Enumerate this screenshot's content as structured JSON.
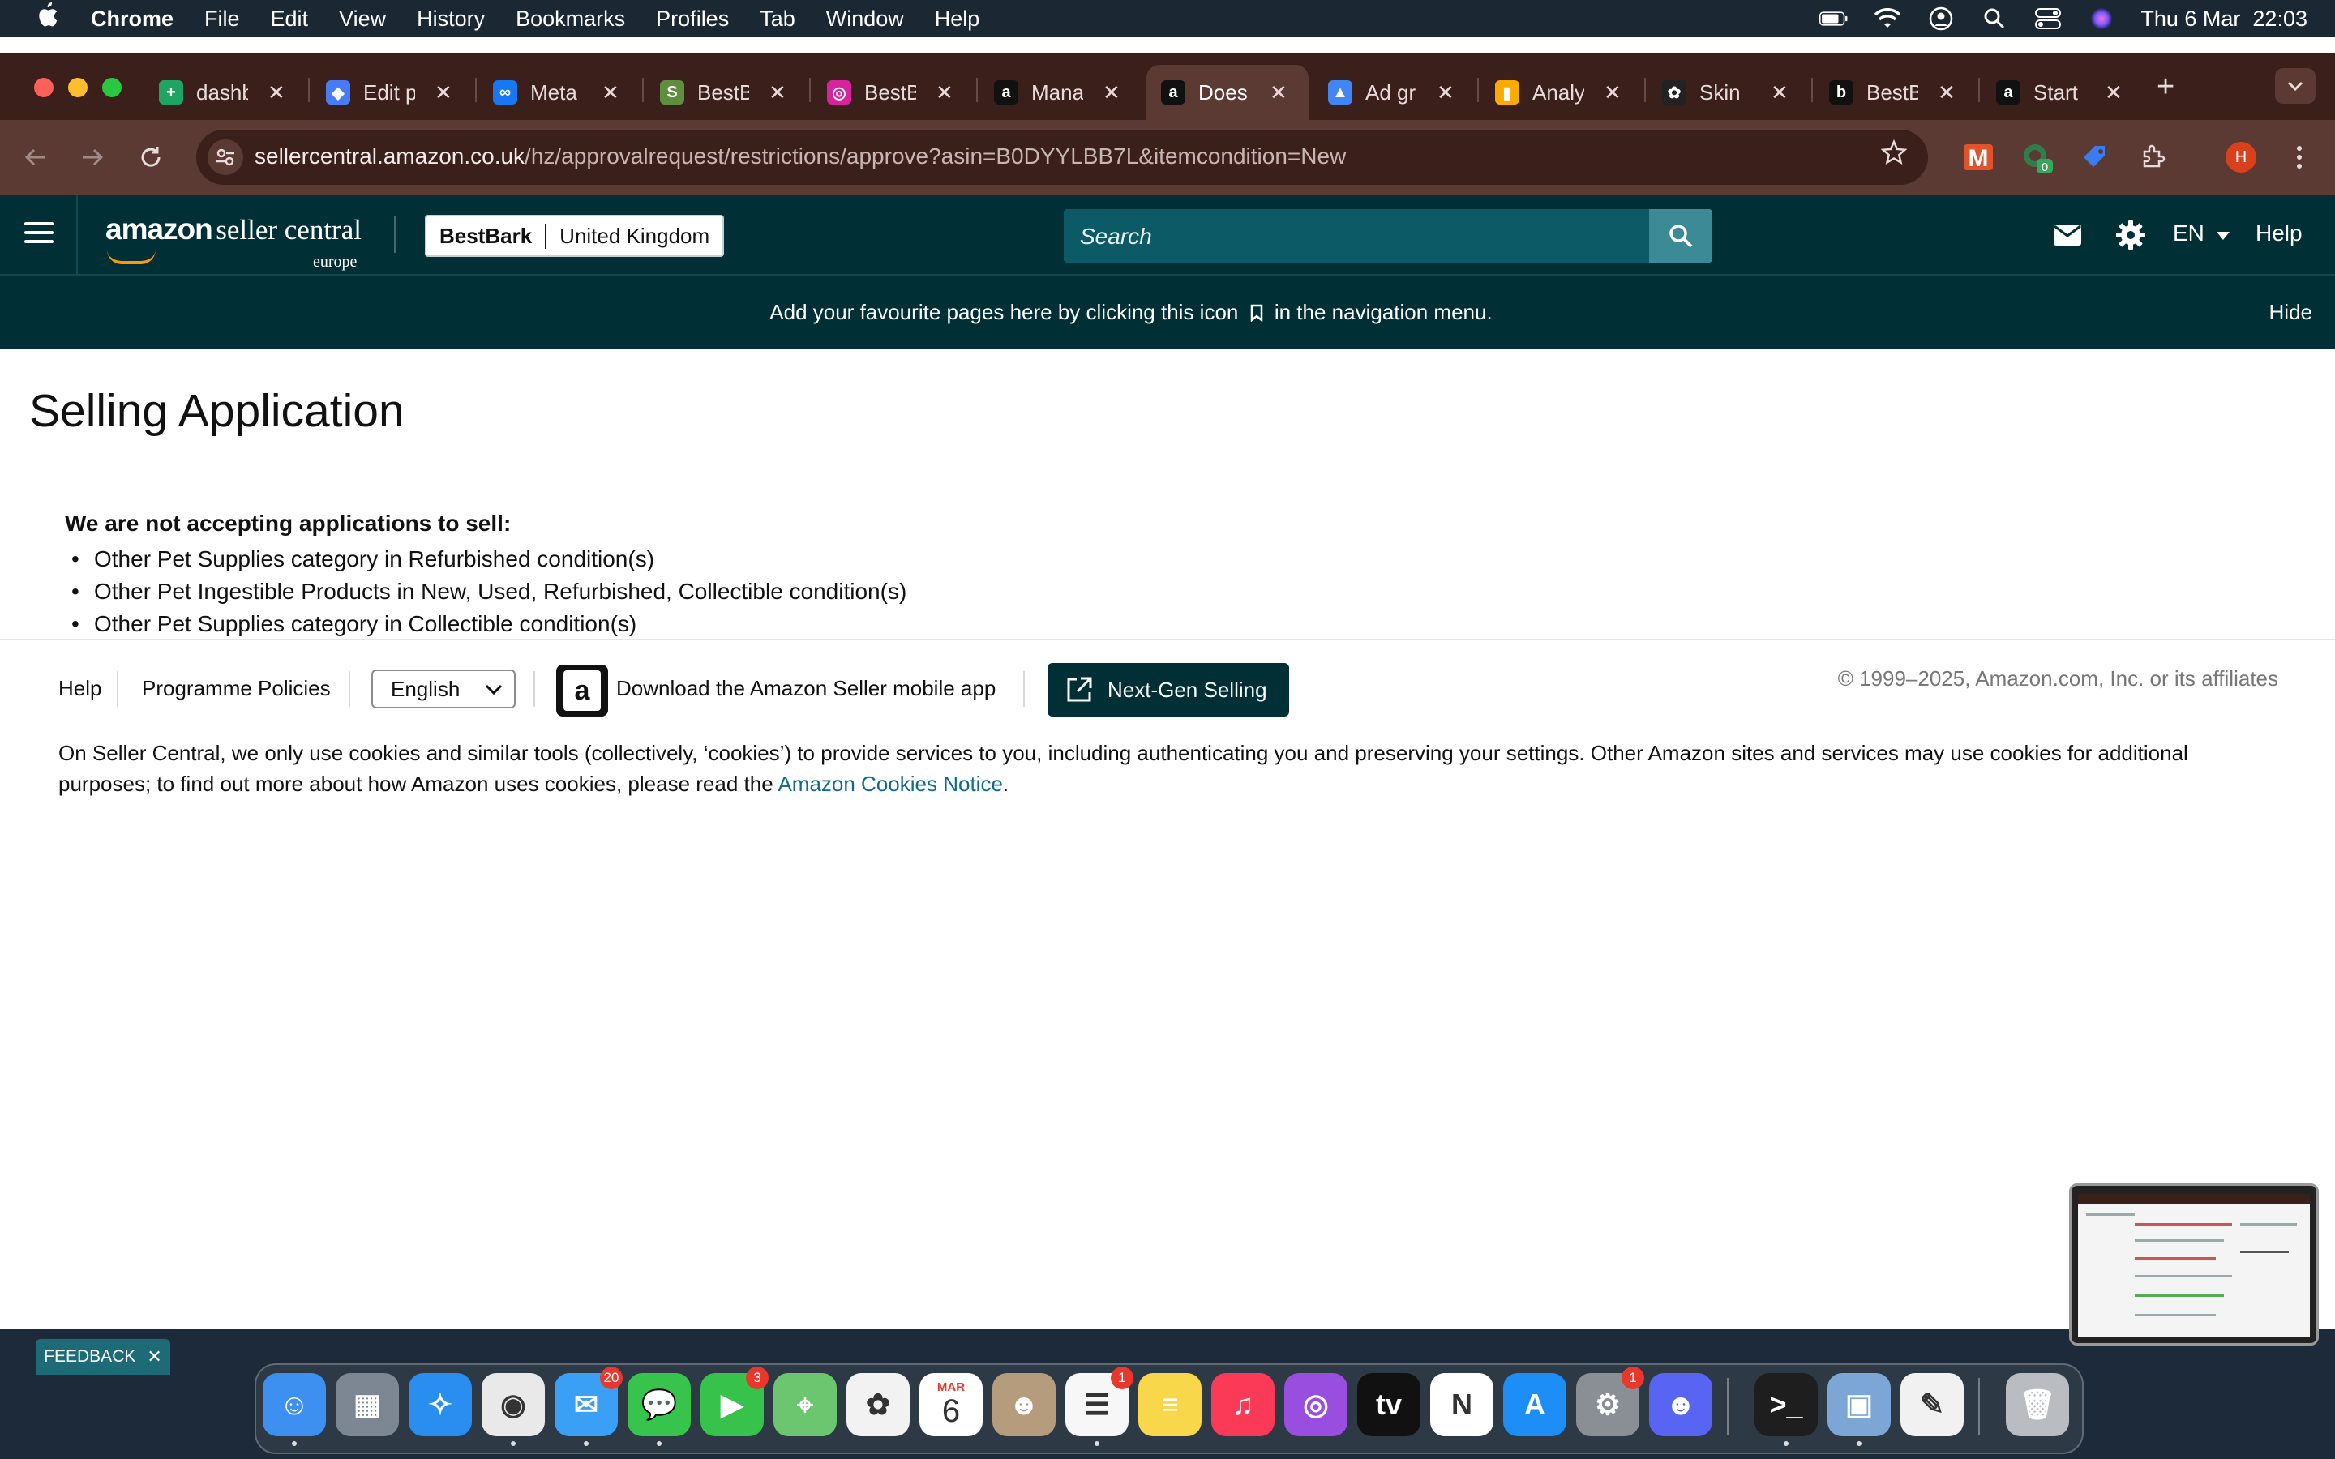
{
  "menubar": {
    "items": [
      "Chrome",
      "File",
      "Edit",
      "View",
      "History",
      "Bookmarks",
      "Profiles",
      "Tab",
      "Window",
      "Help"
    ],
    "datetime": "Thu 6 Mar  22:03"
  },
  "tabs": [
    {
      "title": "dashb",
      "icon": "sheets-icon",
      "color": "#1fa463"
    },
    {
      "title": "Edit p",
      "icon": "tag-icon",
      "color": "#4a7bf7"
    },
    {
      "title": "Meta",
      "icon": "meta-icon",
      "color": "#1877f2"
    },
    {
      "title": "BestB",
      "icon": "shopify-icon",
      "color": "#5e8e3e"
    },
    {
      "title": "BestB",
      "icon": "instagram-icon",
      "color": "#d6249f"
    },
    {
      "title": "Mana",
      "icon": "amazon-icon",
      "color": "#111111"
    },
    {
      "title": "Does",
      "icon": "amazon-icon",
      "color": "#111111",
      "active": true
    },
    {
      "title": "Ad gr",
      "icon": "google-ads-icon",
      "color": "#4285f4"
    },
    {
      "title": "Analy",
      "icon": "analytics-icon",
      "color": "#f9ab00"
    },
    {
      "title": "Skin",
      "icon": "openai-icon",
      "color": "#222222"
    },
    {
      "title": "BestB",
      "icon": "brand-b-icon",
      "color": "#111111"
    },
    {
      "title": "Start",
      "icon": "amazon-icon",
      "color": "#111111"
    }
  ],
  "browser": {
    "url_host": "sellercentral.amazon.co.uk",
    "url_path": "/hz/approvalrequest/restrictions/approve?asin=B0DYYLBB7L&itemcondition=New",
    "profile_initial": "H",
    "extension_badge": "0"
  },
  "header": {
    "logo_amazon": "amazon",
    "logo_seller_central": "seller central",
    "logo_region": "europe",
    "store_name": "BestBark",
    "marketplace": "United Kingdom",
    "search_placeholder": "Search",
    "language": "EN",
    "help": "Help"
  },
  "banner": {
    "message_before": "Add your favourite pages here by clicking this icon",
    "message_after": "in the navigation menu.",
    "hide": "Hide"
  },
  "main": {
    "title": "Selling Application",
    "notice_heading": "We are not accepting applications to sell:",
    "restrictions": [
      "Other Pet Supplies category in Refurbished condition(s)",
      "Other Pet Ingestible Products in New, Used, Refurbished, Collectible condition(s)",
      "Other Pet Supplies category in Collectible condition(s)"
    ]
  },
  "footer": {
    "help": "Help",
    "programme_policies": "Programme Policies",
    "language_selected": "English",
    "download_app": "Download the Amazon Seller mobile app",
    "next_gen": "Next-Gen Selling",
    "copyright": "© 1999–2025, Amazon.com, Inc. or its affiliates",
    "cookies_text": "On Seller Central, we only use cookies and similar tools (collectively, ‘cookies’) to provide services to you, including authenticating you and preserving your settings. Other Amazon sites and services may use cookies for additional purposes; to find out more about how Amazon uses cookies, please read the",
    "cookies_link": "Amazon Cookies Notice",
    "cookies_end": "."
  },
  "feedback": {
    "label": "FEEDBACK"
  },
  "dock": {
    "apps": [
      {
        "name": "finder-icon",
        "color": "#3d8ff0"
      },
      {
        "name": "launchpad-icon",
        "color": "#7d8794"
      },
      {
        "name": "safari-icon",
        "color": "#2a8ef0"
      },
      {
        "name": "chrome-icon",
        "color": "#e9e9e9"
      },
      {
        "name": "mail-icon",
        "color": "#3aa0f5",
        "badge": "20"
      },
      {
        "name": "messages-icon",
        "color": "#37c44d"
      },
      {
        "name": "facetime-icon",
        "color": "#36c24b",
        "badge": "3"
      },
      {
        "name": "maps-icon",
        "color": "#6cc56f"
      },
      {
        "name": "photos-icon",
        "color": "#f2f2f2"
      },
      {
        "name": "calendar-icon",
        "color": "#ffffff",
        "label_top": "MAR",
        "label": "6"
      },
      {
        "name": "contacts-icon",
        "color": "#b49c7c"
      },
      {
        "name": "reminders-icon",
        "color": "#f7f7f7",
        "badge": "1"
      },
      {
        "name": "notes-icon",
        "color": "#f8d84a"
      },
      {
        "name": "music-icon",
        "color": "#fb3a57"
      },
      {
        "name": "podcasts-icon",
        "color": "#9a4ee0"
      },
      {
        "name": "tv-icon",
        "color": "#111111",
        "label": "tv"
      },
      {
        "name": "news-icon",
        "color": "#ffffff"
      },
      {
        "name": "app-store-icon",
        "color": "#1c8ef5"
      },
      {
        "name": "system-settings-icon",
        "color": "#8a8f96",
        "badge": "1"
      },
      {
        "name": "discord-icon",
        "color": "#5865f2"
      },
      {
        "name": "terminal-icon",
        "color": "#1e1e1e"
      },
      {
        "name": "preview-icon",
        "color": "#7ba6d6"
      },
      {
        "name": "textedit-icon",
        "color": "#f1f1f1"
      },
      {
        "name": "trash-icon",
        "color": "#b9bdc2"
      }
    ]
  }
}
